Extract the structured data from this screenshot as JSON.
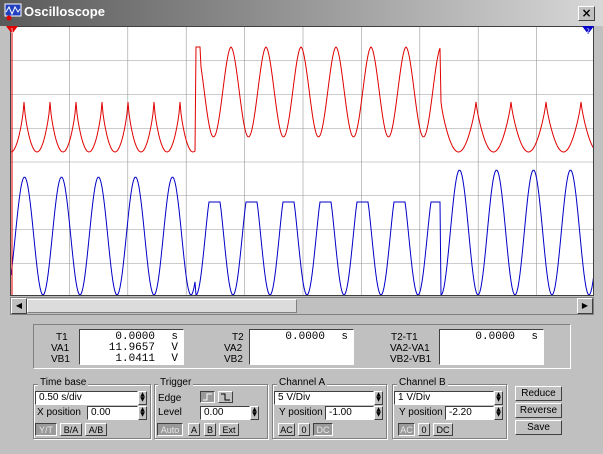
{
  "window": {
    "title": "Oscilloscope",
    "close_glyph": "×"
  },
  "readout": {
    "t1_label": "T1",
    "t1_value": "0.0000",
    "t1_unit": "s",
    "va1_label": "VA1",
    "va1_value": "11.9657",
    "va1_unit": "V",
    "vb1_label": "VB1",
    "vb1_value": "1.0411",
    "vb1_unit": "V",
    "t2_label": "T2",
    "t2_value": "0.0000",
    "t2_unit": "s",
    "va2_label": "VA2",
    "vb2_label": "VB2",
    "t2t1_label": "T2-T1",
    "t2t1_value": "0.0000",
    "t2t1_unit": "s",
    "va2va1_label": "VA2-VA1",
    "vb2vb1_label": "VB2-VB1"
  },
  "timebase": {
    "title": "Time base",
    "value": "0.50 s/div",
    "xpos_label": "X position",
    "xpos_value": "0.00",
    "buttons": [
      "Y/T",
      "B/A",
      "A/B"
    ]
  },
  "trigger": {
    "title": "Trigger",
    "edge_label": "Edge",
    "level_label": "Level",
    "level_value": "0.00",
    "buttons": [
      "Auto",
      "A",
      "B",
      "Ext"
    ]
  },
  "channel_a": {
    "title": "Channel A",
    "scale": "5 V/Div",
    "ypos_label": "Y position",
    "ypos_value": "-1.00",
    "coupling": [
      "AC",
      "0",
      "DC"
    ]
  },
  "channel_b": {
    "title": "Channel B",
    "scale": "1 V/Div",
    "ypos_label": "Y position",
    "ypos_value": "-2.20",
    "coupling": [
      "AC",
      "0",
      "DC"
    ]
  },
  "side_buttons": {
    "reduce": "Reduce",
    "reverse": "Reverse",
    "save": "Save"
  },
  "colors": {
    "channel_a": "#e00000",
    "channel_b": "#0000c8",
    "grid": "#9a9a9a",
    "cursor1": "#e00000",
    "cursor2": "#0000c8"
  },
  "icons": {
    "app": "oscilloscope-icon",
    "cursor1": "cursor-1-marker-icon",
    "cursor2": "cursor-2-marker-icon"
  }
}
